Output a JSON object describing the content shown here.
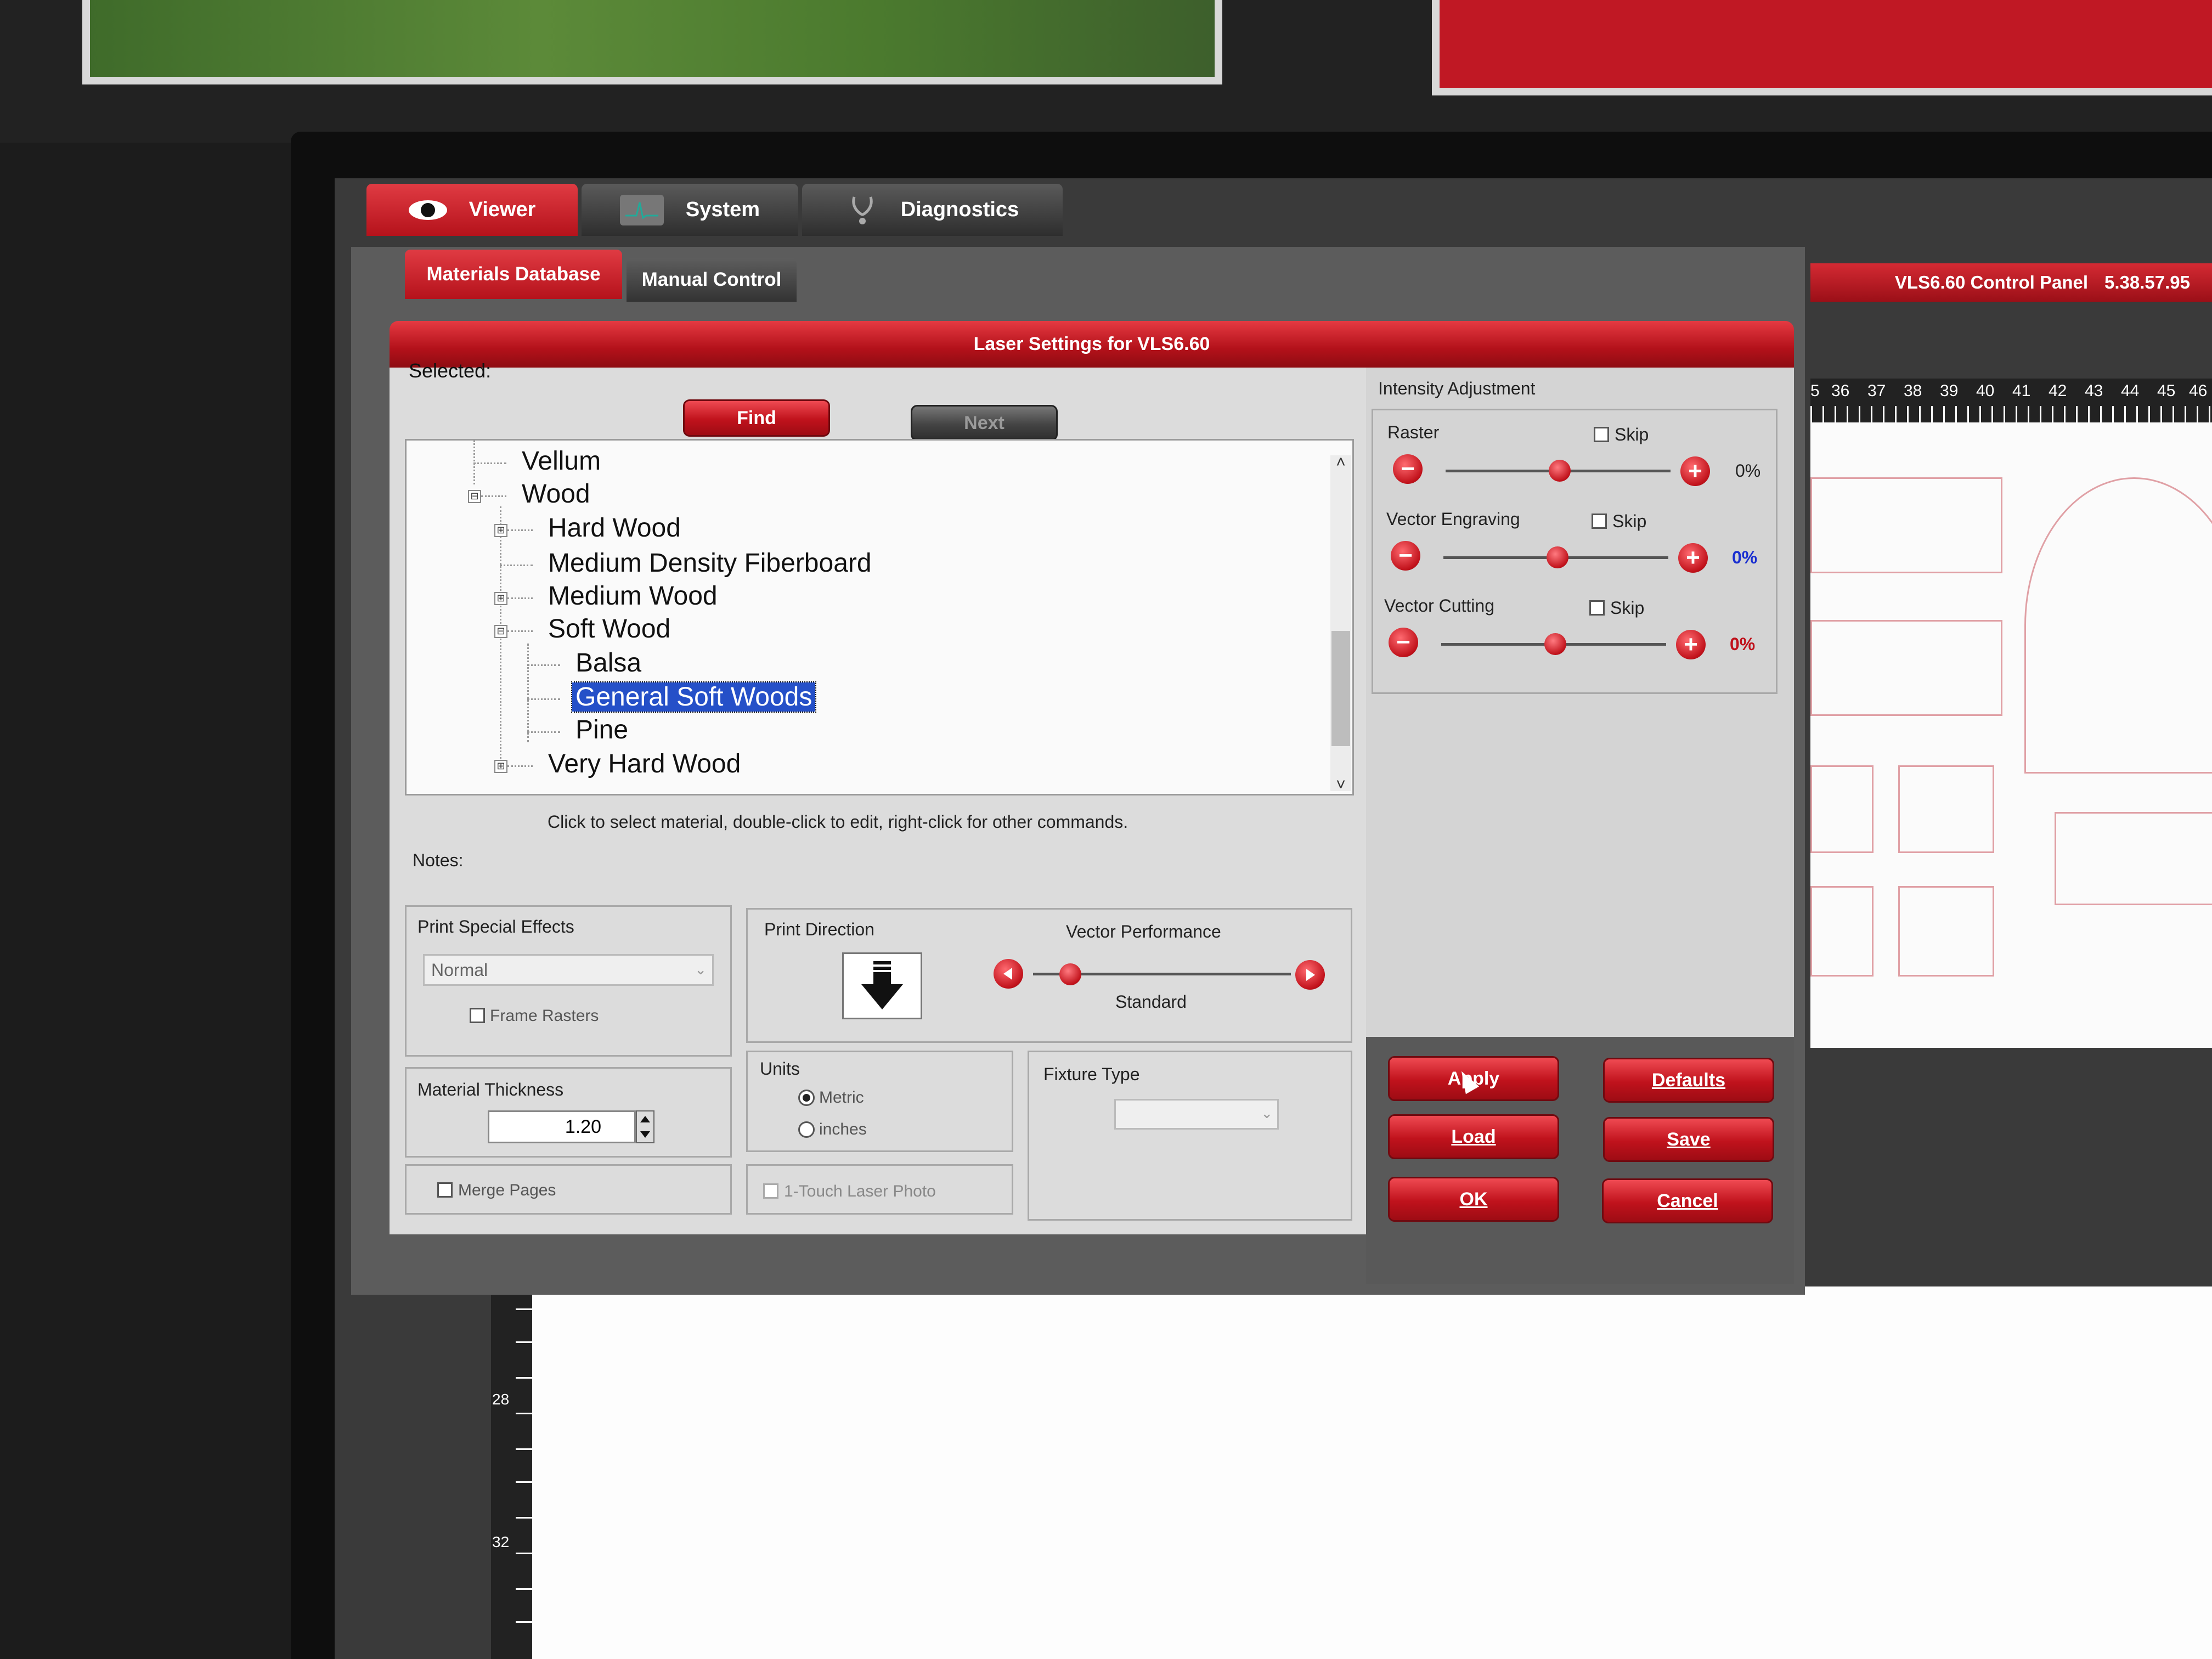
{
  "top_tabs": [
    {
      "label": "Viewer"
    },
    {
      "label": "System"
    },
    {
      "label": "Diagnostics"
    }
  ],
  "control_panel": {
    "title": "VLS6.60 Control Panel",
    "version": "5.38.57.95"
  },
  "ruler_top": [
    "5",
    "36",
    "37",
    "38",
    "39",
    "40",
    "41",
    "42",
    "43",
    "44",
    "45",
    "46"
  ],
  "ruler_left": [
    "28",
    "32"
  ],
  "sub_tabs": [
    {
      "label": "Materials Database"
    },
    {
      "label": "Manual Control"
    }
  ],
  "dialog_title": "Laser Settings for VLS6.60",
  "selected_label": "Selected:",
  "find_button": "Find",
  "next_button": "Next",
  "tree": [
    {
      "label": "Vellum"
    },
    {
      "label": "Wood",
      "expander": "⊟"
    },
    {
      "label": "Hard Wood",
      "expander": "⊞"
    },
    {
      "label": "Medium Density Fiberboard"
    },
    {
      "label": "Medium Wood",
      "expander": "⊞"
    },
    {
      "label": "Soft Wood",
      "expander": "⊟"
    },
    {
      "label": "Balsa"
    },
    {
      "label": "General Soft Woods",
      "selected": true
    },
    {
      "label": "Pine"
    },
    {
      "label": "Very Hard Wood",
      "expander": "⊞"
    }
  ],
  "hint": "Click to select material, double-click to edit, right-click for other commands.",
  "notes_label": "Notes:",
  "print_special_effects": {
    "title": "Print Special Effects",
    "value": "Normal",
    "frame_rasters": "Frame Rasters"
  },
  "print_direction": {
    "title": "Print Direction"
  },
  "vector_performance": {
    "title": "Vector Performance",
    "value": "Standard"
  },
  "material_thickness": {
    "title": "Material Thickness",
    "value": "1.20"
  },
  "units": {
    "title": "Units",
    "metric": "Metric",
    "inches": "inches",
    "selected": "Metric"
  },
  "fixture_type": {
    "title": "Fixture Type"
  },
  "merge_pages": "Merge Pages",
  "one_touch": "1-Touch Laser Photo",
  "intensity": {
    "title": "Intensity Adjustment",
    "rows": [
      {
        "label": "Raster",
        "skip": "Skip",
        "value": "0%",
        "color": "#222222"
      },
      {
        "label": "Vector Engraving",
        "skip": "Skip",
        "value": "0%",
        "color": "#1a2fd0"
      },
      {
        "label": "Vector Cutting",
        "skip": "Skip",
        "value": "0%",
        "color": "#c0121c"
      }
    ]
  },
  "buttons": {
    "apply": "Apply",
    "defaults": "Defaults",
    "load": "Load",
    "save": "Save",
    "ok": "OK",
    "cancel": "Cancel"
  },
  "icons": {
    "viewer": "eye-icon",
    "system": "waveform-icon",
    "diagnostics": "stethoscope-icon",
    "print_direction": "down-arrow-icon"
  },
  "colors": {
    "accent": "#c0121c",
    "selection": "#2550c8",
    "panel": "#dcdcdc"
  }
}
